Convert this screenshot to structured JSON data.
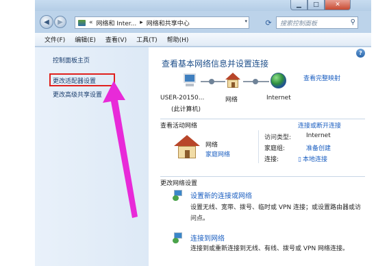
{
  "address": {
    "prefix": "«",
    "crumbs": [
      "网络和 Inter...",
      "网络和共享中心"
    ],
    "sep": "▸",
    "dropdown": "▾"
  },
  "search": {
    "placeholder": "搜索控制面板"
  },
  "menu": [
    "文件(F)",
    "编辑(E)",
    "查看(V)",
    "工具(T)",
    "帮助(H)"
  ],
  "sidebar": {
    "items": [
      {
        "label": "控制面板主页"
      },
      {
        "label": "更改适配器设置"
      },
      {
        "label": "更改高级共享设置"
      }
    ]
  },
  "main": {
    "title": "查看基本网络信息并设置连接",
    "full_map": "查看完整映射",
    "nodes": [
      {
        "label": "USER-20150...",
        "sub": "(此计算机)"
      },
      {
        "label": "网络"
      },
      {
        "label": "Internet"
      }
    ],
    "active_label": "查看活动网络",
    "connect_link": "连接或断开连接",
    "network_name": "网络",
    "network_type": "家庭网络",
    "access_type_key": "访问类型:",
    "access_type_val": "Internet",
    "homegroup_key": "家庭组:",
    "homegroup_val": "准备创建",
    "connection_key": "连接:",
    "connection_val": "本地连接",
    "change_label": "更改网络设置",
    "tasks": [
      {
        "title": "设置新的连接或网络",
        "desc": "设置无线、宽带、拨号、临时或 VPN 连接；或设置路由器或访问点。"
      },
      {
        "title": "连接到网络",
        "desc": "连接到或重新连接到无线、有线、拨号或 VPN 网络连接。"
      }
    ]
  },
  "colors": {
    "highlight_box": "#e0201c",
    "annotation_arrow": "#e82ad8",
    "link": "#1a5ec0"
  },
  "icons": [
    "back-icon",
    "forward-icon",
    "refresh-icon",
    "search-icon",
    "help-icon",
    "computer-icon",
    "house-icon",
    "globe-icon",
    "plug-icon",
    "network-task-icon"
  ]
}
